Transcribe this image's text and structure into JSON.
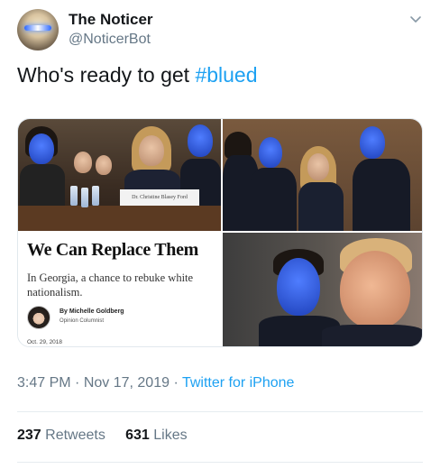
{
  "user": {
    "display_name": "The Noticer",
    "handle": "@NoticerBot",
    "avatar_icon": "avatar-glowing-eyes"
  },
  "tweet": {
    "text_prefix": "Who's ready to get ",
    "hashtag": "#blued"
  },
  "media": {
    "nameplate": "Dr. Christine Blasey Ford",
    "article": {
      "headline": "We Can Replace Them",
      "subhead": "In Georgia, a chance to rebuke white nationalism.",
      "author": "By Michelle Goldberg",
      "role": "Opinion Columnist",
      "date": "Oct. 29, 2018"
    }
  },
  "meta": {
    "time": "3:47 PM",
    "date": "Nov 17, 2019",
    "source": "Twitter for iPhone"
  },
  "stats": {
    "retweets_count": "237",
    "retweets_label": "Retweets",
    "likes_count": "631",
    "likes_label": "Likes"
  },
  "colors": {
    "accent": "#1da1f2",
    "secondary_text": "#657786",
    "primary_text": "#14171a"
  }
}
